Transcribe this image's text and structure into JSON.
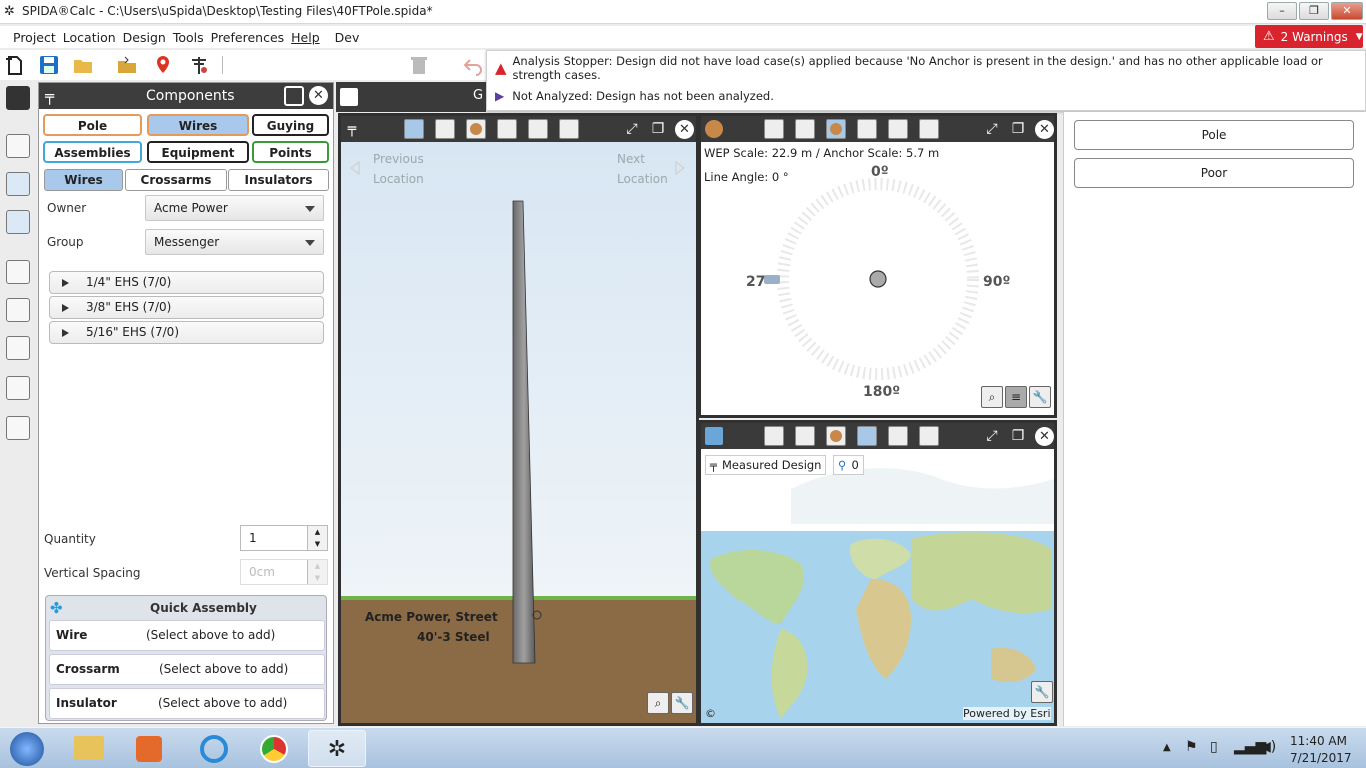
{
  "window": {
    "title": "SPIDA®Calc - C:\\Users\\uSpida\\Desktop\\Testing Files\\40FTPole.spida*",
    "min": "–",
    "max": "❐",
    "close": "✕"
  },
  "menu": [
    "Project",
    "Location",
    "Design",
    "Tools",
    "Preferences",
    "Help",
    "Dev"
  ],
  "warnings": {
    "label": "2 Warnings",
    "color": "#d9232d"
  },
  "notices": [
    "Analysis Stopper: Design did not have load case(s) applied because 'No Anchor is present in the design.' and has no other applicable load or strength cases.",
    "Not Analyzed: Design has not been analyzed."
  ],
  "components": {
    "title": "Components",
    "tabs_row1": [
      "Pole",
      "Wires",
      "Guying"
    ],
    "tabs_row2": [
      "Assemblies",
      "Equipment",
      "Points"
    ],
    "subtabs": [
      "Wires",
      "Crossarms",
      "Insulators"
    ],
    "owner_label": "Owner",
    "owner_value": "Acme Power",
    "group_label": "Group",
    "group_value": "Messenger",
    "wires": [
      "1/4\" EHS (7/0)",
      "3/8\" EHS (7/0)",
      "5/16\" EHS (7/0)"
    ],
    "quantity_label": "Quantity",
    "quantity_value": "1",
    "vspacing_label": "Vertical Spacing",
    "vspacing_placeholder": "0cm",
    "quick_assembly": {
      "title": "Quick Assembly",
      "rows": [
        {
          "name": "Wire",
          "value": "(Select above to add)"
        },
        {
          "name": "Crossarm",
          "value": "(Select above to add)"
        },
        {
          "name": "Insulator",
          "value": "(Select above to add)"
        }
      ]
    }
  },
  "pole_view": {
    "header_text": "G",
    "prev": "Previous",
    "prev2": "Location",
    "next": "Next",
    "next2": "Location",
    "owner_label": "Acme Power, Street",
    "pole_label": "40'-3 Steel"
  },
  "plan_view": {
    "wep": "WEP Scale: 22.9 m / Anchor Scale: 5.7 m",
    "line_angle": "Line Angle: 0 °",
    "n": "0º",
    "e": "90º",
    "s": "180º",
    "w": "27"
  },
  "map_view": {
    "design_label": "Measured Design",
    "search_count": "0",
    "copyright": "©",
    "powered": "Powered by Esri"
  },
  "right_panel": {
    "buttons": [
      "Pole",
      "Poor"
    ]
  },
  "taskbar": {
    "time": "11:40 AM",
    "date": "7/21/2017"
  }
}
